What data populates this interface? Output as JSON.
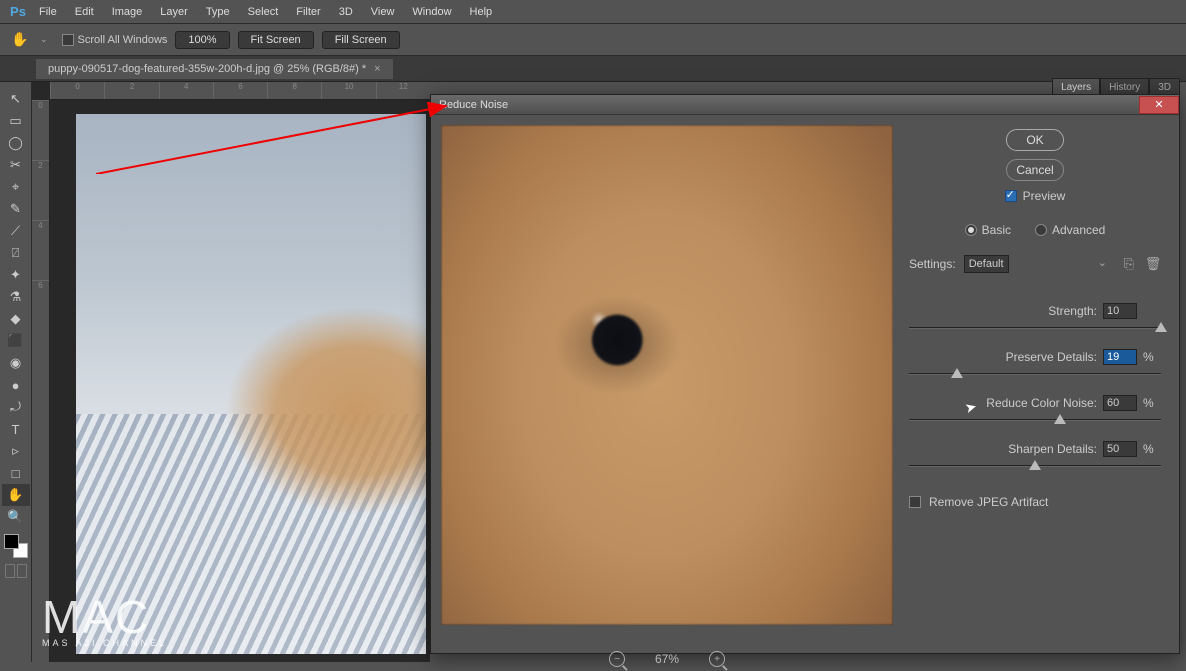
{
  "app": {
    "logo": "Ps"
  },
  "menu": [
    "File",
    "Edit",
    "Image",
    "Layer",
    "Type",
    "Select",
    "Filter",
    "3D",
    "View",
    "Window",
    "Help"
  ],
  "options": {
    "scroll_all": "Scroll All Windows",
    "zoom_pct": "100%",
    "fit": "Fit Screen",
    "fill": "Fill Screen"
  },
  "doc_tab": {
    "title": "puppy-090517-dog-featured-355w-200h-d.jpg @ 25% (RGB/8#) *"
  },
  "ruler_h": [
    "0",
    "2",
    "4",
    "6",
    "8",
    "10",
    "12"
  ],
  "ruler_v": [
    "0",
    "2",
    "4",
    "6"
  ],
  "right_tabs": [
    "Layers",
    "History",
    "3D"
  ],
  "dialog": {
    "title": "Reduce Noise",
    "ok": "OK",
    "cancel": "Cancel",
    "preview": "Preview",
    "basic": "Basic",
    "advanced": "Advanced",
    "settings_label": "Settings:",
    "settings_value": "Default",
    "sliders": {
      "strength": {
        "label": "Strength:",
        "value": "10",
        "pct": "",
        "pos": 100
      },
      "preserve": {
        "label": "Preserve Details:",
        "value": "19",
        "pct": "%",
        "pos": 19
      },
      "color": {
        "label": "Reduce Color Noise:",
        "value": "60",
        "pct": "%",
        "pos": 60
      },
      "sharpen": {
        "label": "Sharpen Details:",
        "value": "50",
        "pct": "%",
        "pos": 50
      }
    },
    "jpeg": "Remove JPEG Artifact",
    "zoom": "67%"
  },
  "watermark": {
    "big": "MAC",
    "small": "MAS AJI CHANNEL"
  },
  "tools": [
    "↖",
    "▭",
    "◯",
    "✂",
    "⌖",
    "✎",
    "⟋",
    "⍁",
    "✦",
    "⚗",
    "◆",
    "⬛",
    "◉",
    "●",
    "⤾",
    "✐",
    "T",
    "▹",
    "□",
    "✋",
    "🔍"
  ]
}
